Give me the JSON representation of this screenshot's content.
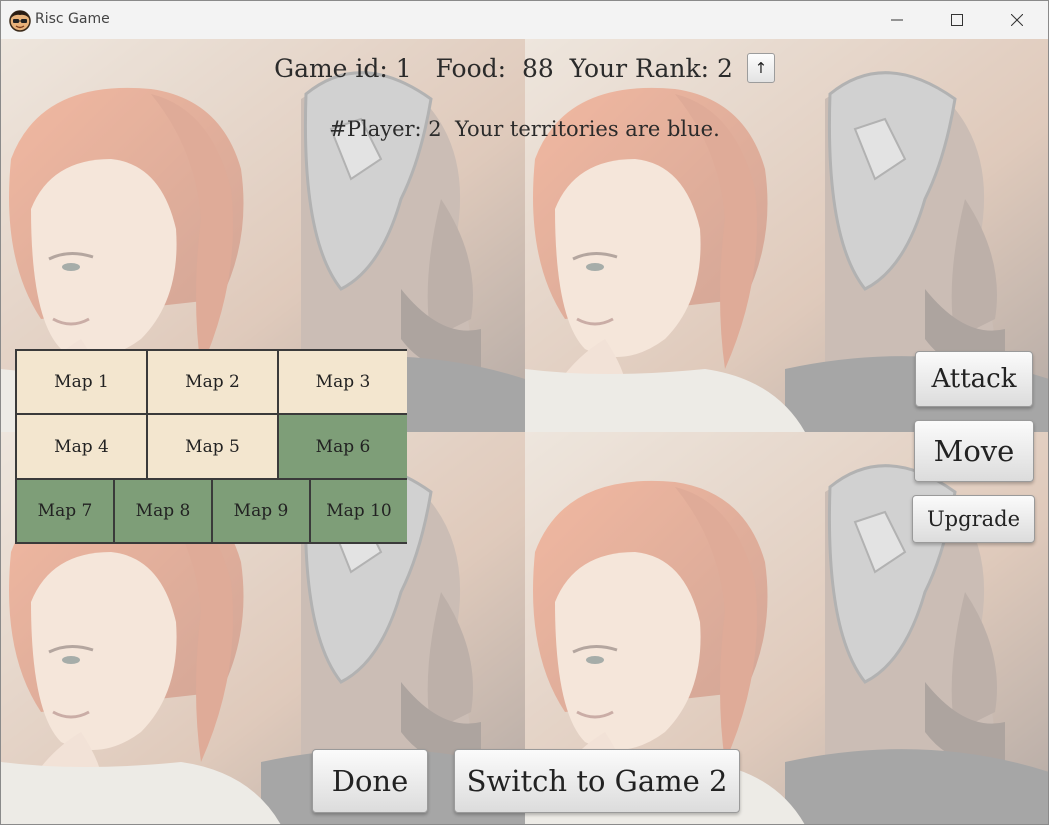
{
  "window": {
    "title": "Risc Game",
    "icon": "cartoon-face-with-glasses-icon",
    "controls": [
      "minimize-icon",
      "maximize-icon",
      "close-icon"
    ]
  },
  "header": {
    "game_id_label": "Game id: 1",
    "food_label": "Food:  88",
    "rank_label": "Your Rank: 2",
    "sort_button_label": "↑"
  },
  "info": {
    "players_label": "#Player: 2  Your territories are blue."
  },
  "maps": [
    {
      "label": "Map 1",
      "color": "#f3e6cf"
    },
    {
      "label": "Map 2",
      "color": "#f3e6cf"
    },
    {
      "label": "Map 3",
      "color": "#f3e6cf"
    },
    {
      "label": "Map 4",
      "color": "#f3e6cf"
    },
    {
      "label": "Map 5",
      "color": "#f3e6cf"
    },
    {
      "label": "Map 6",
      "color": "#7e9e78"
    },
    {
      "label": "Map 7",
      "color": "#7e9e78"
    },
    {
      "label": "Map 8",
      "color": "#7e9e78"
    },
    {
      "label": "Map 9",
      "color": "#7e9e78"
    },
    {
      "label": "Map 10",
      "color": "#7e9e78"
    }
  ],
  "actions": {
    "attack_label": "Attack",
    "move_label": "Move",
    "upgrade_label": "Upgrade"
  },
  "footer": {
    "done_label": "Done",
    "switch_label": "Switch to Game 2"
  },
  "background": {
    "image": "warrior-woman-and-armored-man-portrait",
    "tiles": 4
  }
}
